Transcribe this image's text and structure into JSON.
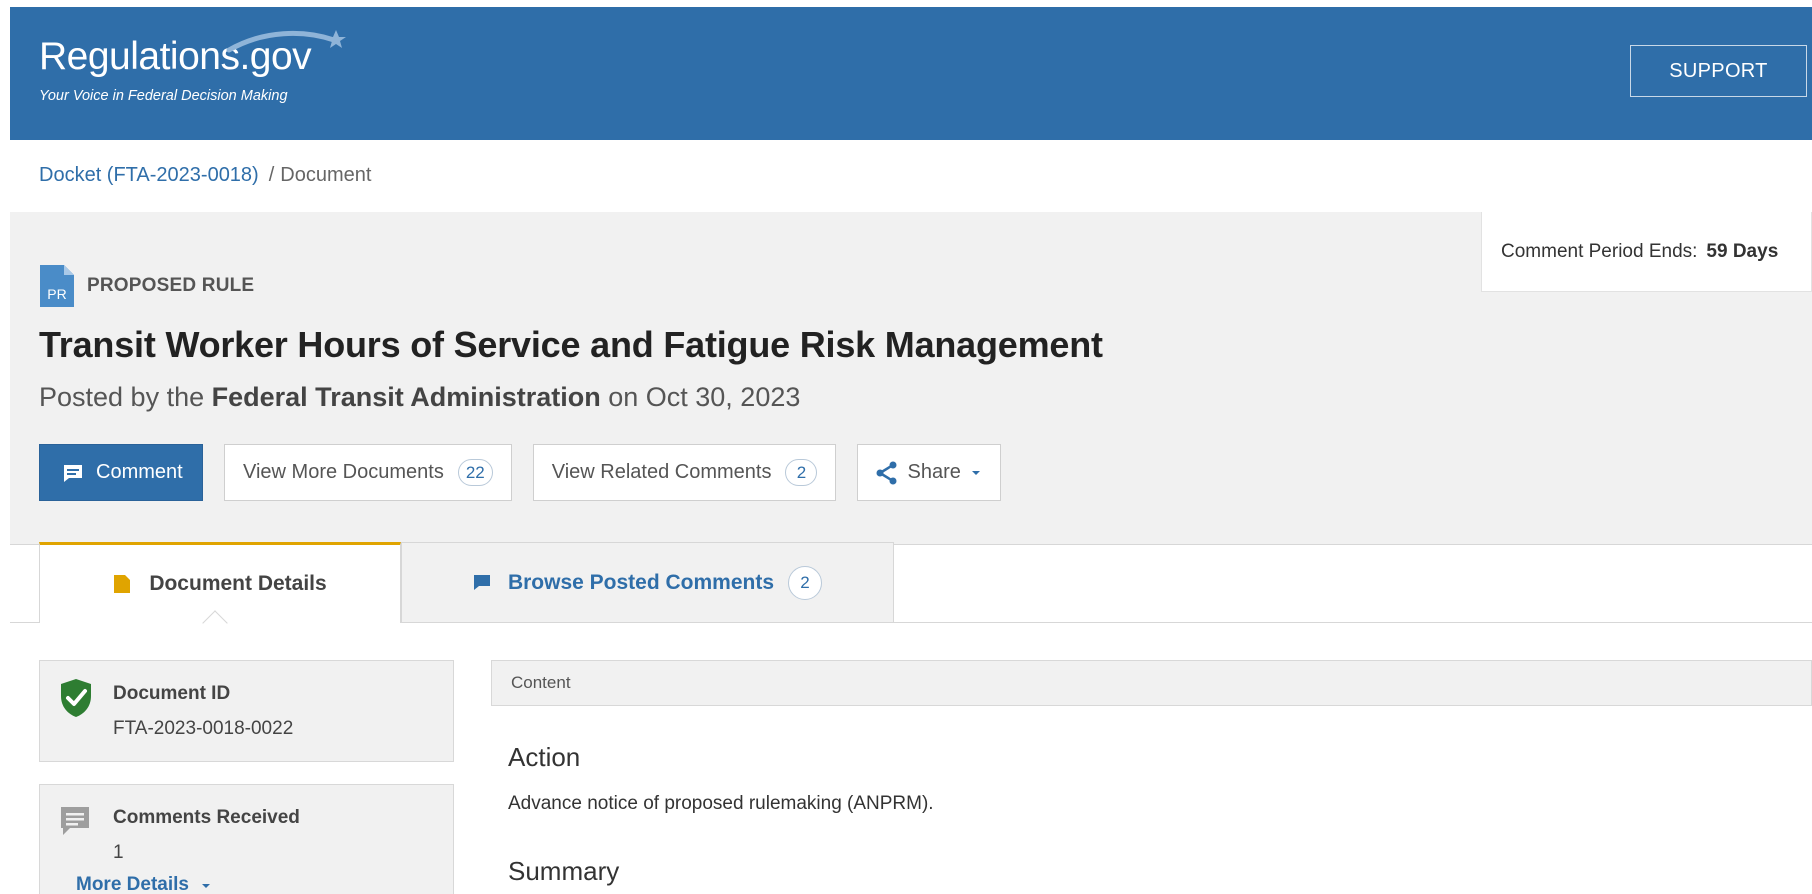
{
  "header": {
    "logo_title": "Regulations.gov",
    "logo_tagline": "Your Voice in Federal Decision Making",
    "support_label": "SUPPORT",
    "bg_color": "#2f6ea9"
  },
  "breadcrumb": {
    "docket_link": "Docket (FTA-2023-0018)",
    "separator": "/",
    "current": "Document"
  },
  "comment_period": {
    "label": "Comment Period Ends:",
    "value": "59 Days"
  },
  "document": {
    "type_icon_text": "PR",
    "type_label": "PROPOSED RULE",
    "title": "Transit Worker Hours of Service and Fatigue Risk Management",
    "posted_prefix": "Posted by the",
    "agency": "Federal Transit Administration",
    "posted_suffix": "on Oct 30, 2023"
  },
  "actions": {
    "comment_label": "Comment",
    "view_more_docs_label": "View More Documents",
    "view_more_docs_count": "22",
    "view_related_label": "View Related Comments",
    "view_related_count": "2",
    "share_label": "Share"
  },
  "tabs": {
    "details_label": "Document Details",
    "browse_label": "Browse Posted Comments",
    "browse_count": "2",
    "active_accent": "#e0a400"
  },
  "sidebar": {
    "doc_id_title": "Document ID",
    "doc_id_value": "FTA-2023-0018-0022",
    "comments_title": "Comments Received",
    "comments_value": "1",
    "more_details_label": "More Details"
  },
  "content": {
    "bar_label": "Content",
    "action_heading": "Action",
    "action_text": "Advance notice of proposed rulemaking (ANPRM).",
    "summary_heading": "Summary"
  }
}
